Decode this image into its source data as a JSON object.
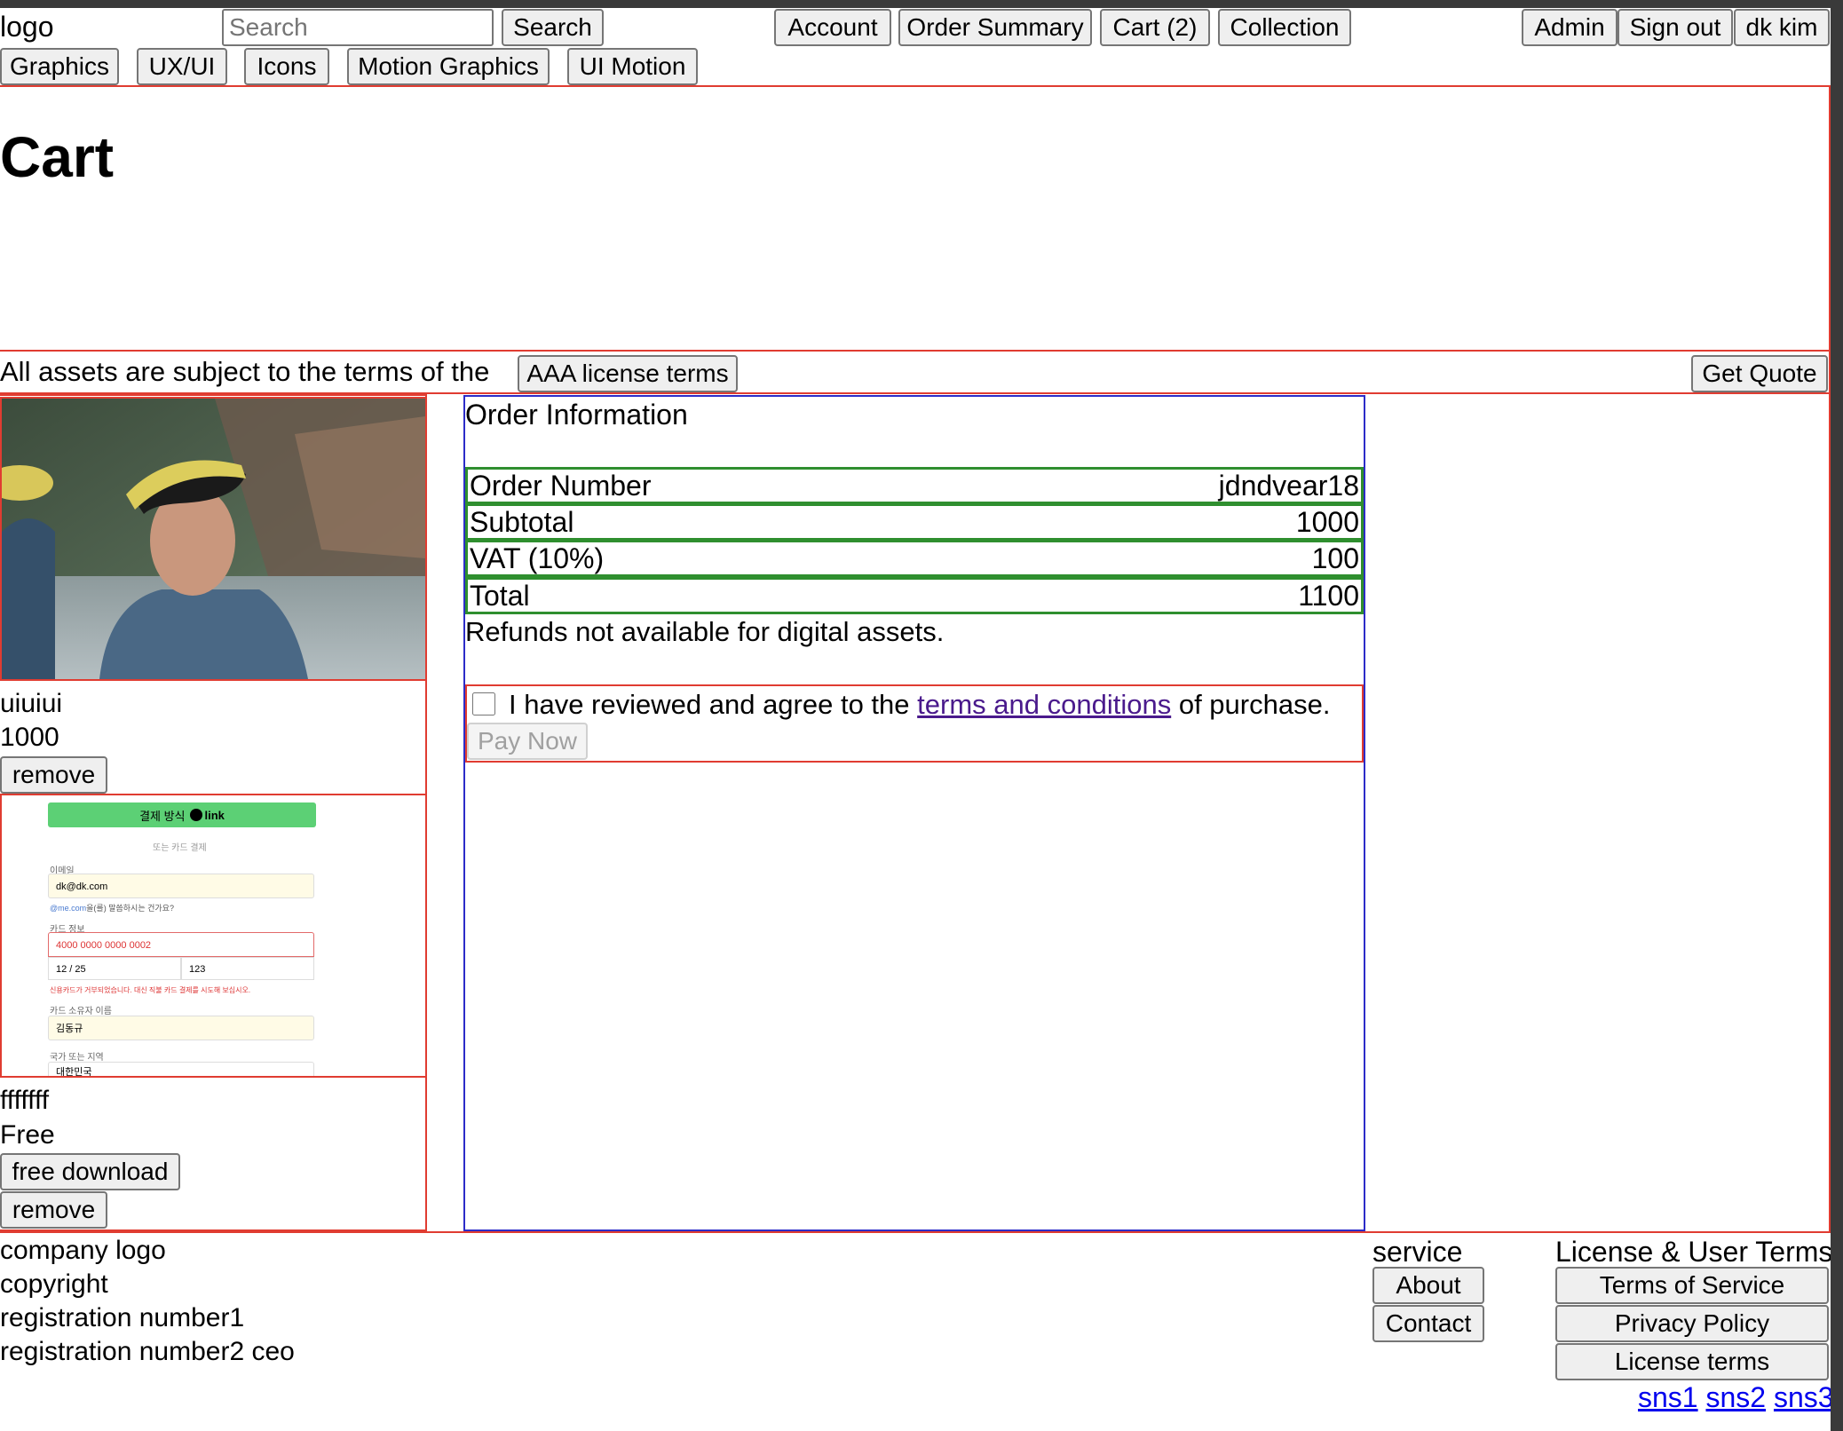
{
  "header": {
    "logo": "logo",
    "search_placeholder": "Search",
    "search_button": "Search",
    "nav": {
      "account": "Account",
      "order_summary": "Order Summary",
      "cart": "Cart (2)",
      "collection": "Collection"
    },
    "user": {
      "admin": "Admin",
      "sign_out": "Sign out",
      "name": "dk kim"
    },
    "categories": [
      "Graphics",
      "UX/UI",
      "Icons",
      "Motion Graphics",
      "UI Motion"
    ]
  },
  "page_title": "Cart",
  "license_bar": {
    "text": "All assets are subject to the terms of the",
    "license_button": "AAA license terms",
    "quote_button": "Get Quote"
  },
  "cart_items": [
    {
      "name": "uiuiui",
      "price": "1000",
      "remove_label": "remove"
    },
    {
      "name": "fffffff",
      "price": "Free",
      "download_label": "free download",
      "remove_label": "remove"
    }
  ],
  "thumb2": {
    "banner": "결제 방식",
    "banner_brand": "link",
    "or_card": "또는 카드 결제",
    "email_label": "이메일",
    "email_value": "dk@dk.com",
    "email_hint_domain": "@me.com",
    "email_hint": "을(를) 말씀하시는 건가요?",
    "card_label": "카드 정보",
    "card_number": "4000 0000 0000 0002",
    "card_exp": "12 / 25",
    "card_cvc": "123",
    "card_error": "신용카드가 거부되었습니다. 대신 직불 카드 결제를 시도해 보십시오.",
    "holder_label": "카드 소유자 이름",
    "holder_value": "김동규",
    "country_label": "국가 또는 지역",
    "country_value": "대한민국"
  },
  "order": {
    "heading": "Order Information",
    "rows": [
      {
        "label": "Order Number",
        "value": "jdndvear18"
      },
      {
        "label": "Subtotal",
        "value": "1000"
      },
      {
        "label": "VAT (10%)",
        "value": "100"
      },
      {
        "label": "Total",
        "value": "1100"
      }
    ],
    "refund_note": "Refunds not available for digital assets.",
    "agree_prefix": "I have reviewed and agree to the",
    "agree_link": "terms and conditions",
    "agree_suffix": "of purchase.",
    "pay_button": "Pay Now"
  },
  "footer": {
    "company_logo": "company logo",
    "copyright": "copyright",
    "reg1": "registration number1",
    "reg2": "registration number2 ceo",
    "service_heading": "service",
    "about": "About",
    "contact": "Contact",
    "license_heading": "License & User Terms",
    "terms": "Terms of Service",
    "privacy": "Privacy Policy",
    "license_terms": "License terms",
    "sns": [
      "sns1",
      "sns2",
      "sns3"
    ]
  },
  "colors": {
    "section_border": "#e03c31",
    "order_border": "#2c2cc8",
    "row_border": "#2f8f2f",
    "link_banner": "#5cd075"
  }
}
